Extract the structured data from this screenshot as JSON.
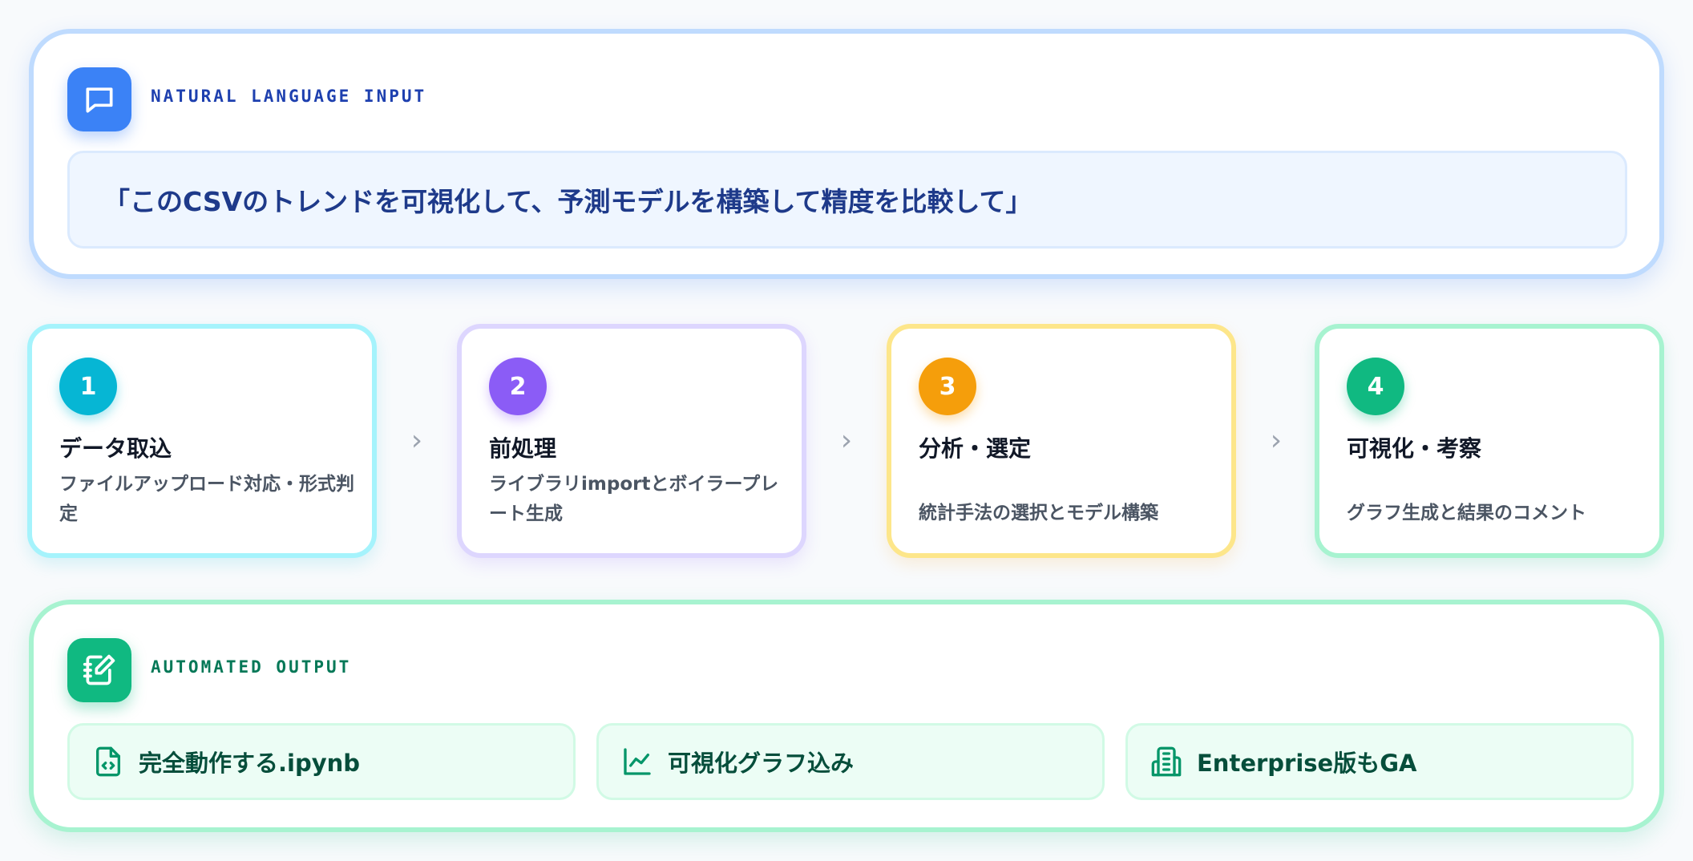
{
  "input": {
    "header_label": "NATURAL LANGUAGE INPUT",
    "prompt": "「このCSVのトレンドを可視化して、予測モデルを構築して精度を比較して」"
  },
  "steps": [
    {
      "number": "1",
      "title": "データ取込",
      "description": "ファイルアップロード対応・形式判定"
    },
    {
      "number": "2",
      "title": "前処理",
      "description": "ライブラリimportとボイラープレート生成"
    },
    {
      "number": "3",
      "title": "分析・選定",
      "description": "統計手法の選択とモデル構築"
    },
    {
      "number": "4",
      "title": "可視化・考察",
      "description": "グラフ生成と結果のコメント"
    }
  ],
  "output": {
    "header_label": "AUTOMATED OUTPUT",
    "items": [
      {
        "label": "完全動作する.ipynb",
        "icon": "notebook-file-icon"
      },
      {
        "label": "可視化グラフ込み",
        "icon": "line-chart-icon"
      },
      {
        "label": "Enterprise版もGA",
        "icon": "building-icon"
      }
    ]
  },
  "colors": {
    "input_accent": "#3b82f6",
    "step1": "#06b6d4",
    "step2": "#8b5cf6",
    "step3": "#f59e0b",
    "step4": "#10b981",
    "output_accent": "#10b981"
  }
}
